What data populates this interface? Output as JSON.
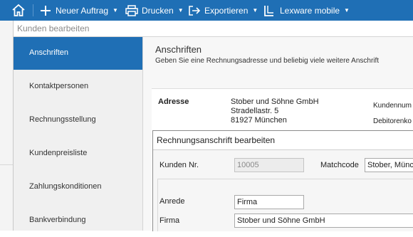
{
  "toolbar": {
    "new_order": "Neuer Auftrag",
    "print": "Drucken",
    "export": "Exportieren",
    "mobile": "Lexware mobile"
  },
  "window": {
    "title": "Kunden bearbeiten"
  },
  "sidebar": {
    "items": [
      {
        "label": "Anschriften",
        "active": true
      },
      {
        "label": "Kontaktpersonen",
        "active": false
      },
      {
        "label": "Rechnungsstellung",
        "active": false
      },
      {
        "label": "Kundenpreisliste",
        "active": false
      },
      {
        "label": "Zahlungskonditionen",
        "active": false
      },
      {
        "label": "Bankverbindung",
        "active": false
      }
    ]
  },
  "main": {
    "title": "Anschriften",
    "description": "Geben Sie eine Rechnungsadresse und beliebig viele weitere Anschrift",
    "address": {
      "label": "Adresse",
      "lines": [
        "Stober und Söhne GmbH",
        "Stradellastr. 5",
        "81927 München"
      ],
      "right_labels": [
        "Kundennum",
        "Debitorenko"
      ]
    }
  },
  "dialog": {
    "title": "Rechnungsanschrift bearbeiten",
    "customer_no_label": "Kunden Nr.",
    "customer_no_value": "10005",
    "matchcode_label": "Matchcode",
    "matchcode_value": "Stober, Münc",
    "salutation_label": "Anrede",
    "salutation_value": "Firma",
    "company_label": "Firma",
    "company_value": "Stober und Söhne GmbH"
  },
  "colors": {
    "accent": "#1f6fb5"
  }
}
